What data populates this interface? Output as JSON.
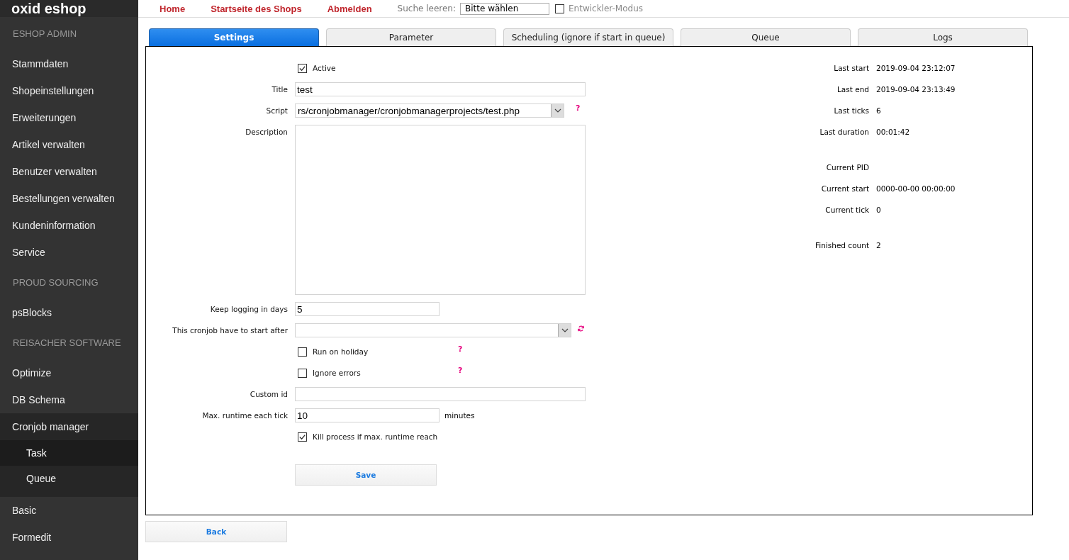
{
  "topbar": {
    "logo": "oxid eshop",
    "links": [
      "Home",
      "Startseite des Shops",
      "Abmelden"
    ],
    "search_label": "Suche leeren:",
    "search_select": "Bitte wählen",
    "dev_mode": {
      "label": "Entwickler-Modus",
      "checked": false
    }
  },
  "sidebar": {
    "sections": [
      {
        "heading": "ESHOP ADMIN",
        "items": [
          {
            "label": "Stammdaten",
            "selected": false
          },
          {
            "label": "Shopeinstellungen",
            "selected": false
          },
          {
            "label": "Erweiterungen",
            "selected": false
          },
          {
            "label": "Artikel verwalten",
            "selected": false
          },
          {
            "label": "Benutzer verwalten",
            "selected": false
          },
          {
            "label": "Bestellungen verwalten",
            "selected": false
          },
          {
            "label": "Kundeninformation",
            "selected": false
          },
          {
            "label": "Service",
            "selected": false
          }
        ]
      },
      {
        "heading": "PROUD SOURCING",
        "items": [
          {
            "label": "psBlocks",
            "selected": false
          }
        ]
      },
      {
        "heading": "REISACHER SOFTWARE",
        "items": [
          {
            "label": "Optimize",
            "selected": false
          },
          {
            "label": "DB Schema",
            "selected": false
          },
          {
            "label": "Cronjob manager",
            "selected": false,
            "expanded": true,
            "children": [
              {
                "label": "Task",
                "selected": true
              },
              {
                "label": "Queue",
                "selected": false
              }
            ]
          },
          {
            "label": "Basic",
            "selected": false
          },
          {
            "label": "Formedit",
            "selected": false
          }
        ]
      }
    ]
  },
  "tabs": [
    {
      "label": "Settings",
      "selected": true
    },
    {
      "label": "Parameter",
      "selected": false
    },
    {
      "label": "Scheduling (ignore if start in queue)",
      "selected": false
    },
    {
      "label": "Queue",
      "selected": false
    },
    {
      "label": "Logs",
      "selected": false
    }
  ],
  "form": [
    {
      "kind": "checkbox",
      "label": "Active",
      "checked": true
    },
    {
      "kind": "text",
      "label": "Title",
      "value": "test"
    },
    {
      "kind": "select",
      "label": "Script",
      "value": "rs/cronjobmanager/cronjobmanagerprojects/test.php",
      "help": "?"
    },
    {
      "kind": "textarea",
      "label": "Description"
    },
    {
      "kind": "number",
      "label": "Keep logging in days",
      "value": "5"
    },
    {
      "kind": "select",
      "label": "This cronjob have to start after",
      "refresh": true
    },
    {
      "kind": "checkbox",
      "label": "Run on holiday",
      "checked": false,
      "help": "?"
    },
    {
      "kind": "checkbox",
      "label": "Ignore errors",
      "checked": false,
      "help": "?"
    },
    {
      "kind": "text",
      "label": "Custom id"
    },
    {
      "kind": "number",
      "label": "Max. runtime each tick",
      "value": "10",
      "suffix": "minutes"
    },
    {
      "kind": "checkbox",
      "label": "Kill process if max. runtime reach",
      "checked": true
    },
    {
      "kind": "button",
      "label": "Save"
    }
  ],
  "info": [
    [
      {
        "label": "Last start",
        "value": "2019-09-04 23:12:07"
      },
      {
        "label": "Last end",
        "value": "2019-09-04 23:13:49"
      },
      {
        "label": "Last ticks",
        "value": "6"
      },
      {
        "label": "Last duration",
        "value": "00:01:42"
      }
    ],
    [
      {
        "label": "Current PID"
      },
      {
        "label": "Current start",
        "value": "0000-00-00 00:00:00"
      },
      {
        "label": "Current tick",
        "value": "0"
      }
    ],
    [
      {
        "label": "Finished count",
        "value": "2"
      }
    ]
  ],
  "back_button": "Back"
}
